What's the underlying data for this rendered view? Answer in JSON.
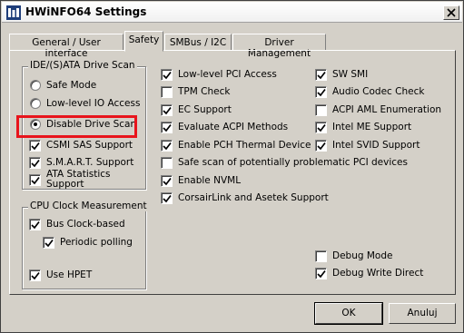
{
  "window": {
    "title": "HWiNFO64 Settings"
  },
  "tabs": [
    {
      "label": "General / User Interface",
      "active": false
    },
    {
      "label": "Safety",
      "active": true
    },
    {
      "label": "SMBus / I2C",
      "active": false
    },
    {
      "label": "Driver Management",
      "active": false
    }
  ],
  "ide_group": {
    "title": "IDE/(S)ATA Drive Scan",
    "radios": [
      {
        "label": "Safe Mode",
        "selected": false
      },
      {
        "label": "Low-level IO Access",
        "selected": false
      },
      {
        "label": "Disable Drive Scan",
        "selected": true
      }
    ],
    "checks": [
      {
        "label": "CSMI SAS Support",
        "checked": true
      },
      {
        "label": "S.M.A.R.T. Support",
        "checked": true
      },
      {
        "label": "ATA Statistics Support",
        "checked": true
      }
    ]
  },
  "cpu_group": {
    "title": "CPU Clock Measurement",
    "checks": [
      {
        "label": "Bus Clock-based",
        "checked": true
      },
      {
        "label": "Periodic polling",
        "checked": true
      },
      {
        "label": "Use HPET",
        "checked": true
      }
    ]
  },
  "mid_checks": [
    {
      "label": "Low-level PCI Access",
      "checked": true
    },
    {
      "label": "TPM Check",
      "checked": false
    },
    {
      "label": "EC Support",
      "checked": true
    },
    {
      "label": "Evaluate ACPI Methods",
      "checked": true
    },
    {
      "label": "Enable PCH Thermal Device",
      "checked": true
    },
    {
      "label": "Safe scan of potentially problematic PCI devices",
      "checked": false
    },
    {
      "label": "Enable NVML",
      "checked": true
    },
    {
      "label": "CorsairLink and Asetek Support",
      "checked": true
    }
  ],
  "right_checks": [
    {
      "label": "SW SMI",
      "checked": true
    },
    {
      "label": "Audio Codec Check",
      "checked": true
    },
    {
      "label": "ACPI AML Enumeration",
      "checked": false
    },
    {
      "label": "Intel ME Support",
      "checked": true
    },
    {
      "label": "Intel SVID Support",
      "checked": true
    }
  ],
  "debug_checks": [
    {
      "label": "Debug Mode",
      "checked": false
    },
    {
      "label": "Debug Write Direct",
      "checked": true
    }
  ],
  "buttons": {
    "ok": "OK",
    "cancel": "Anuluj"
  },
  "colors": {
    "highlight": "#e8141c",
    "face": "#d4d0c8"
  }
}
